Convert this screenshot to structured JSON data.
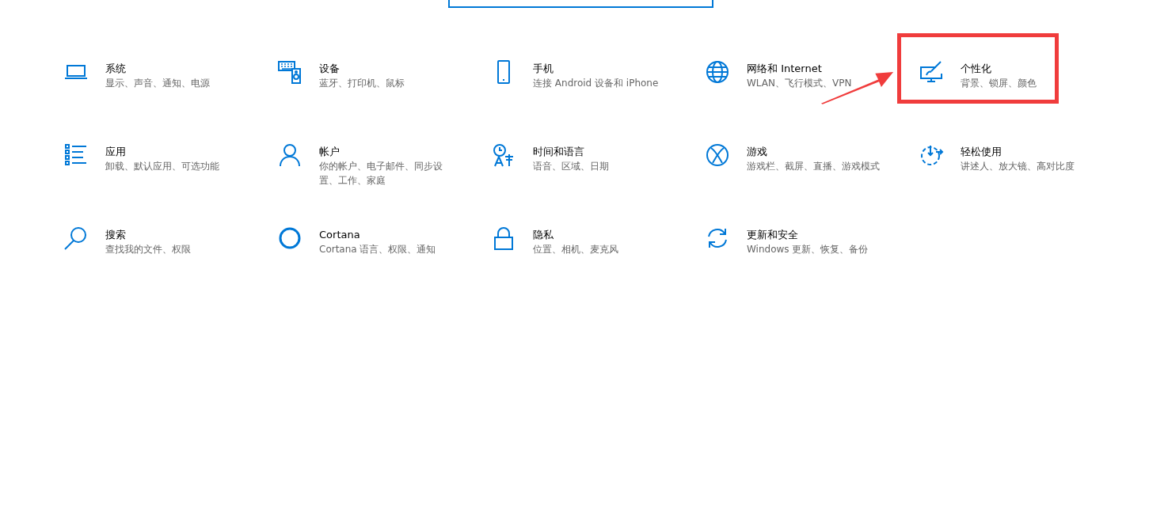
{
  "search": {
    "focused": true
  },
  "categories": [
    {
      "title": "系统",
      "subtitle": "显示、声音、通知、电源",
      "highlighted": false
    },
    {
      "title": "设备",
      "subtitle": "蓝牙、打印机、鼠标",
      "highlighted": false
    },
    {
      "title": "手机",
      "subtitle": "连接 Android 设备和 iPhone",
      "highlighted": false
    },
    {
      "title": "网络和 Internet",
      "subtitle": "WLAN、飞行模式、VPN",
      "highlighted": false
    },
    {
      "title": "个性化",
      "subtitle": "背景、锁屏、颜色",
      "highlighted": true
    },
    {
      "title": "应用",
      "subtitle": "卸载、默认应用、可选功能",
      "highlighted": false
    },
    {
      "title": "帐户",
      "subtitle": "你的帐户、电子邮件、同步设置、工作、家庭",
      "highlighted": false
    },
    {
      "title": "时间和语言",
      "subtitle": "语音、区域、日期",
      "highlighted": false
    },
    {
      "title": "游戏",
      "subtitle": "游戏栏、截屏、直播、游戏模式",
      "highlighted": false
    },
    {
      "title": "轻松使用",
      "subtitle": "讲述人、放大镜、高对比度",
      "highlighted": false
    },
    {
      "title": "搜索",
      "subtitle": "查找我的文件、权限",
      "highlighted": false
    },
    {
      "title": "Cortana",
      "subtitle": "Cortana 语言、权限、通知",
      "highlighted": false
    },
    {
      "title": "隐私",
      "subtitle": "位置、相机、麦克风",
      "highlighted": false
    },
    {
      "title": "更新和安全",
      "subtitle": "Windows 更新、恢复、备份",
      "highlighted": false
    }
  ]
}
